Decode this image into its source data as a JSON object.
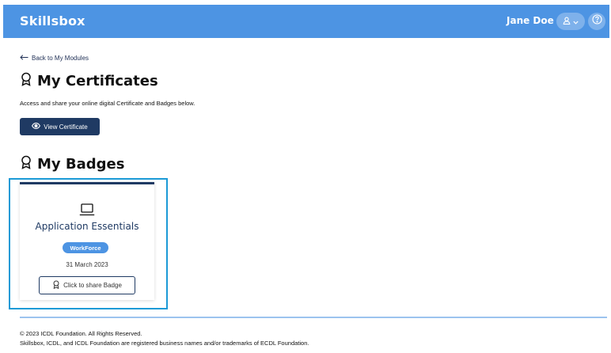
{
  "header": {
    "brand": "Skillsbox",
    "user_name": "Jane Doe",
    "user_icon": "user-icon",
    "help_icon": "help-icon"
  },
  "nav": {
    "back_label": "Back to My Modules"
  },
  "certificates": {
    "heading": "My Certificates",
    "description": "Access and share your online digital Certificate and Badges below.",
    "view_button": "View Certificate"
  },
  "badges": {
    "heading": "My Badges",
    "items": [
      {
        "title": "Application Essentials",
        "tag": "WorkForce",
        "date": "31 March 2023",
        "share_label": "Click to share Badge",
        "icon": "laptop-icon"
      }
    ]
  },
  "footer": {
    "copyright": "© 2023 ICDL Foundation. All Rights Reserved.",
    "trademark": "Skillsbox, ICDL, and ICDL Foundation are registered business names and/or trademarks of ECDL Foundation."
  },
  "colors": {
    "header_bg": "#4d94e3",
    "primary_dark": "#1f3a63",
    "highlight": "#1c9ad6",
    "footer_line": "#9cc3ef"
  }
}
